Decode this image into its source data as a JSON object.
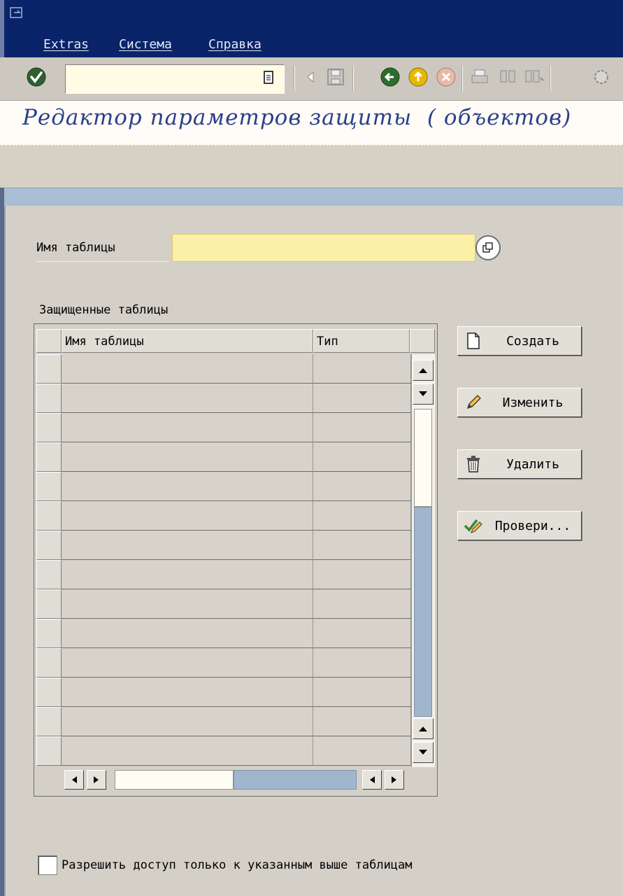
{
  "menu": {
    "items": [
      {
        "label": "Extras"
      },
      {
        "label": "Система"
      },
      {
        "label": "Справка"
      }
    ]
  },
  "toolbar": {
    "command_field_value": "",
    "icons": [
      "ok-icon",
      "back-arrow-icon",
      "save-icon",
      "back-icon",
      "exit-icon",
      "cancel-icon",
      "print-icon",
      "find-icon",
      "find-next-icon",
      "settings-icon"
    ]
  },
  "page": {
    "title": "Редактор параметров защиты  ( объектов)"
  },
  "form": {
    "table_name_label": "Имя таблицы",
    "table_name_value": ""
  },
  "protected_tables": {
    "group_title": "Защищенные таблицы",
    "columns": [
      "Имя таблицы",
      "Тип"
    ],
    "rows": [
      {
        "name": "",
        "type": ""
      },
      {
        "name": "",
        "type": ""
      },
      {
        "name": "",
        "type": ""
      },
      {
        "name": "",
        "type": ""
      },
      {
        "name": "",
        "type": ""
      },
      {
        "name": "",
        "type": ""
      },
      {
        "name": "",
        "type": ""
      },
      {
        "name": "",
        "type": ""
      },
      {
        "name": "",
        "type": ""
      },
      {
        "name": "",
        "type": ""
      },
      {
        "name": "",
        "type": ""
      },
      {
        "name": "",
        "type": ""
      },
      {
        "name": "",
        "type": ""
      },
      {
        "name": "",
        "type": ""
      }
    ]
  },
  "actions": {
    "create": "Создать",
    "change": "Изменить",
    "delete": "Удалить",
    "check": "Провери..."
  },
  "checkbox": {
    "label": "Разрешить доступ только к указанным выше таблицам",
    "checked": false
  },
  "colors": {
    "menubar": "#0a246a",
    "title_text": "#2a3f8c",
    "required_field": "#fbf0a8",
    "scroll_thumb": "#9fb6cc"
  }
}
